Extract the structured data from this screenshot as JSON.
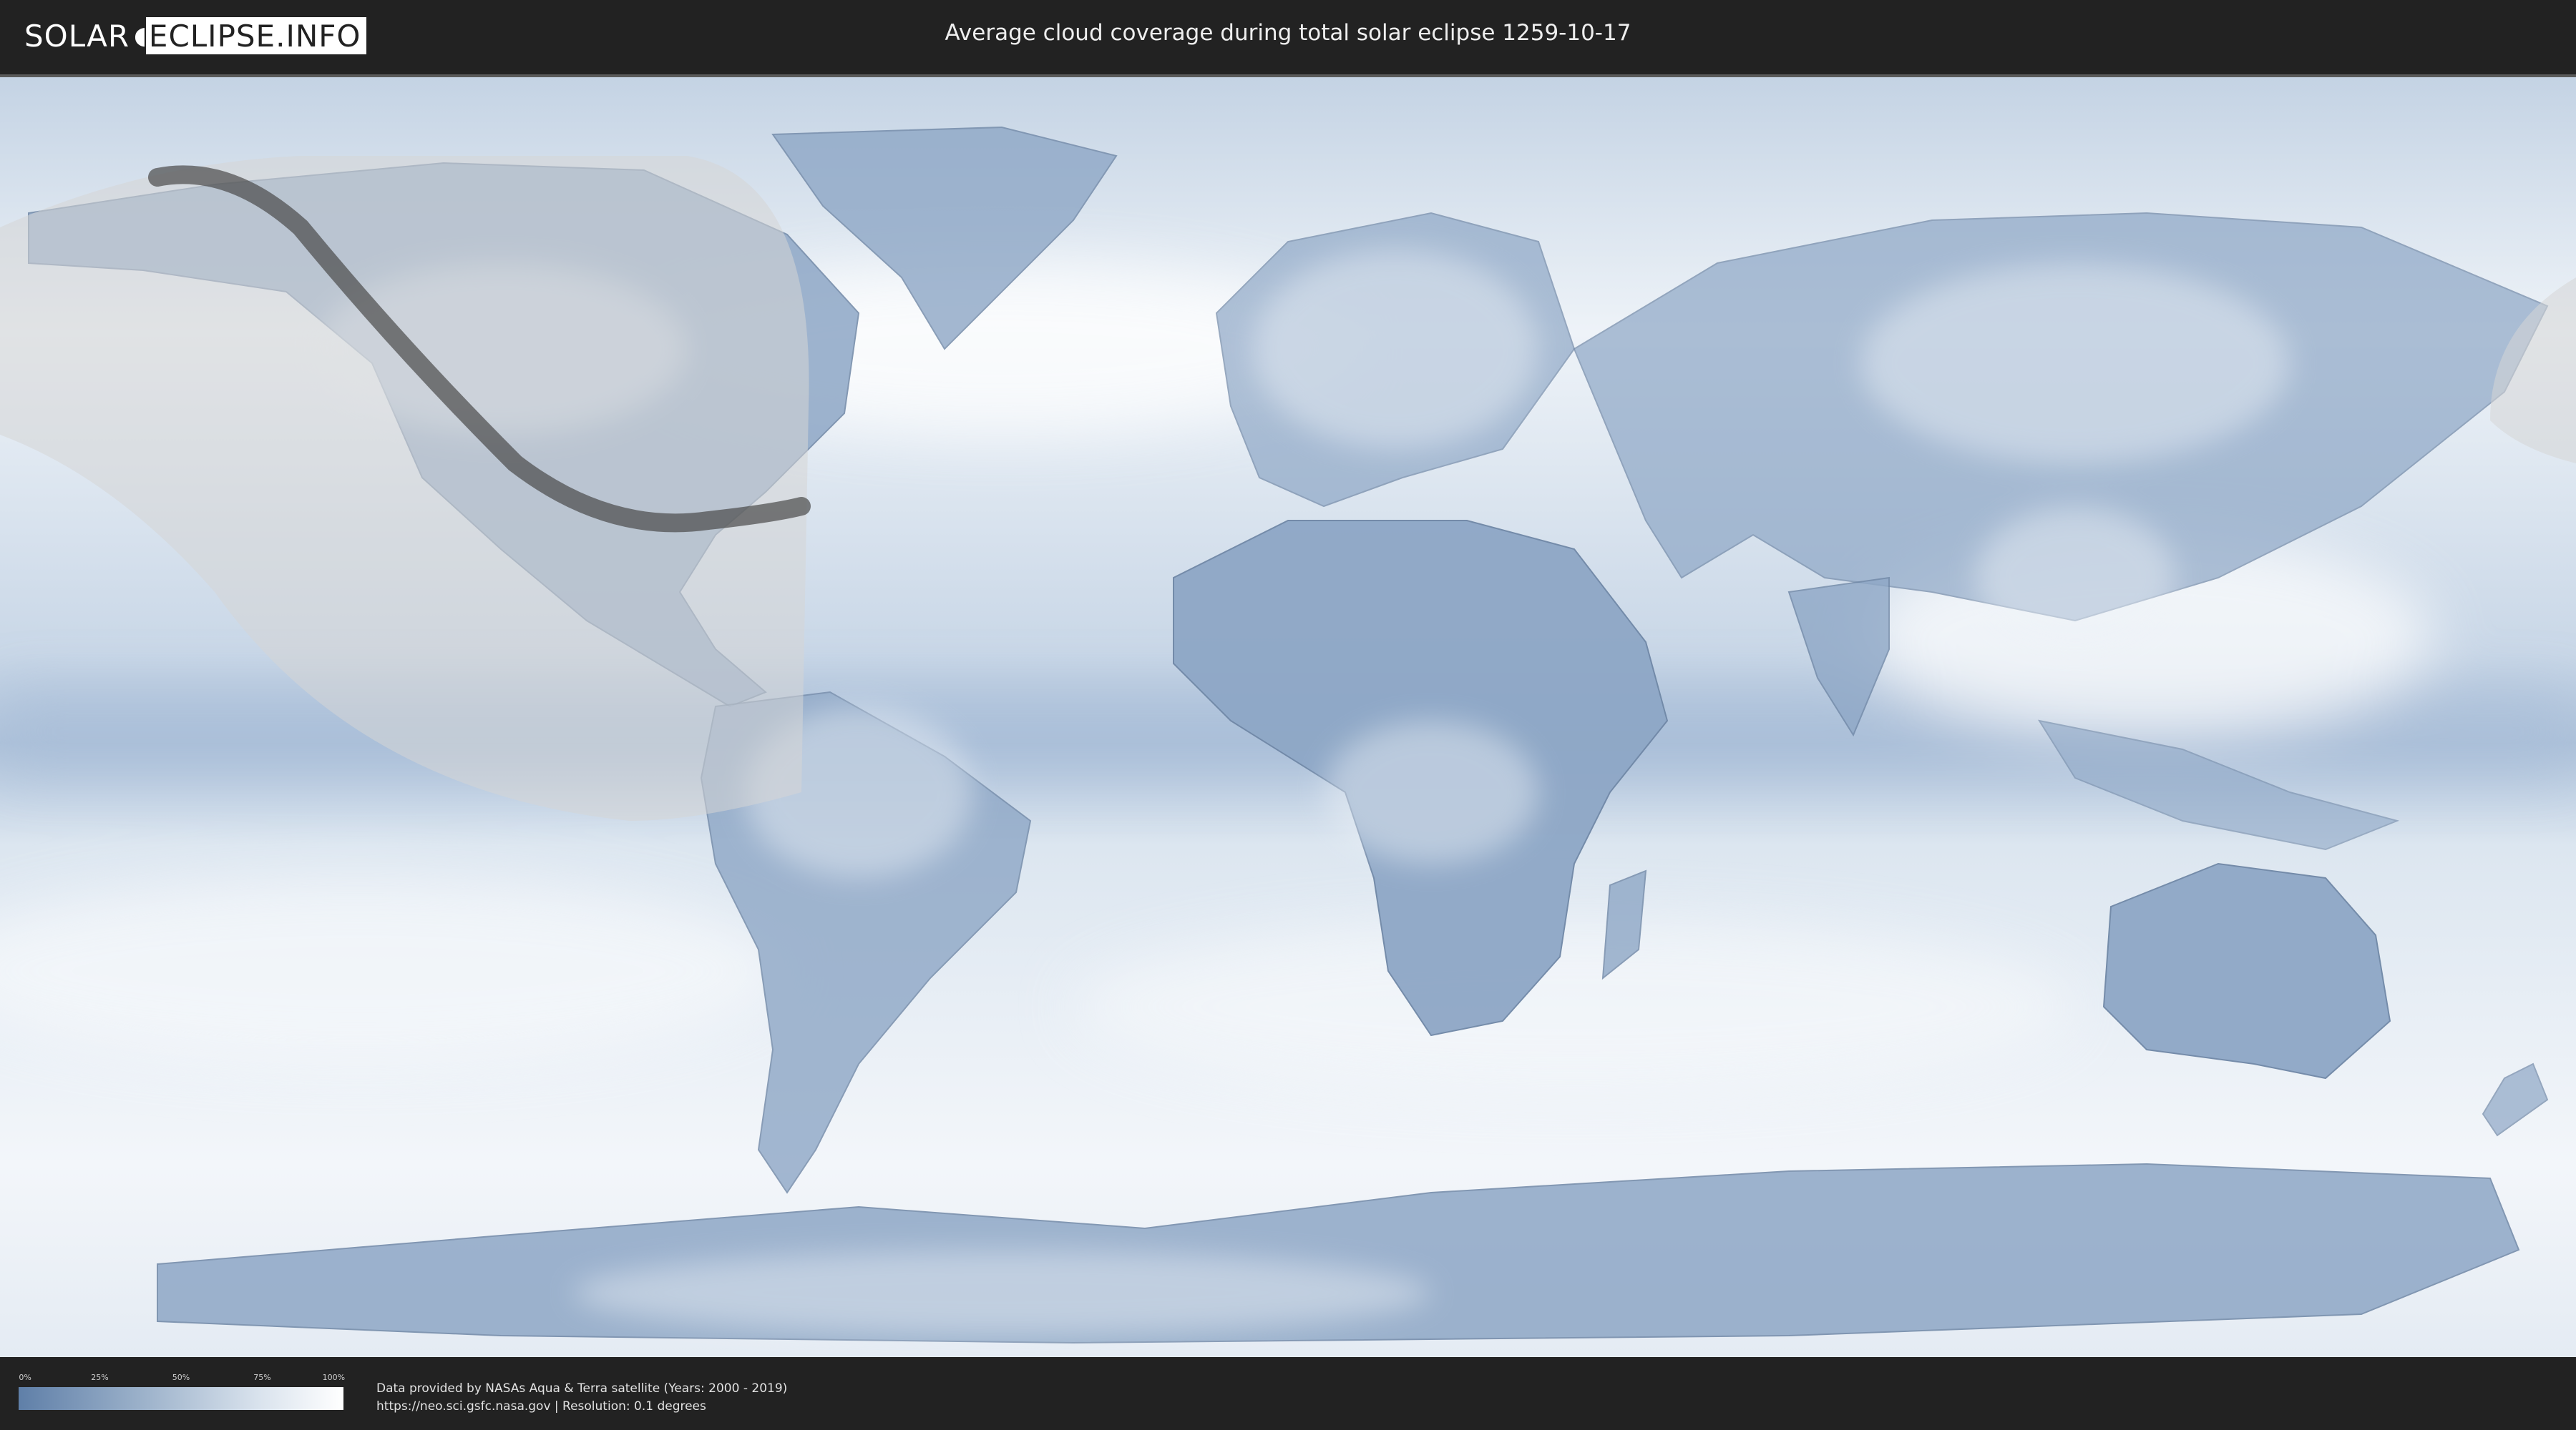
{
  "header": {
    "logo_left": "SOLAR",
    "logo_right": "ECLIPSE.INFO",
    "title": "Average cloud coverage during total solar eclipse 1259-10-17"
  },
  "legend": {
    "ticks": [
      "0%",
      "25%",
      "50%",
      "75%",
      "100%"
    ],
    "colors": {
      "low": "#5f7fa8",
      "high": "#ffffff"
    }
  },
  "footer": {
    "line1": "Data provided by NASAs Aqua & Terra satellite (Years: 2000 - 2019)",
    "line2": "https://neo.sci.gsfc.nasa.gov | Resolution: 0.1 degrees"
  },
  "colors": {
    "background": "#222222",
    "map_cloud": "#dfe8f1",
    "map_clear": "#6c8bb3",
    "eclipse_path": "#4a4a4a"
  }
}
